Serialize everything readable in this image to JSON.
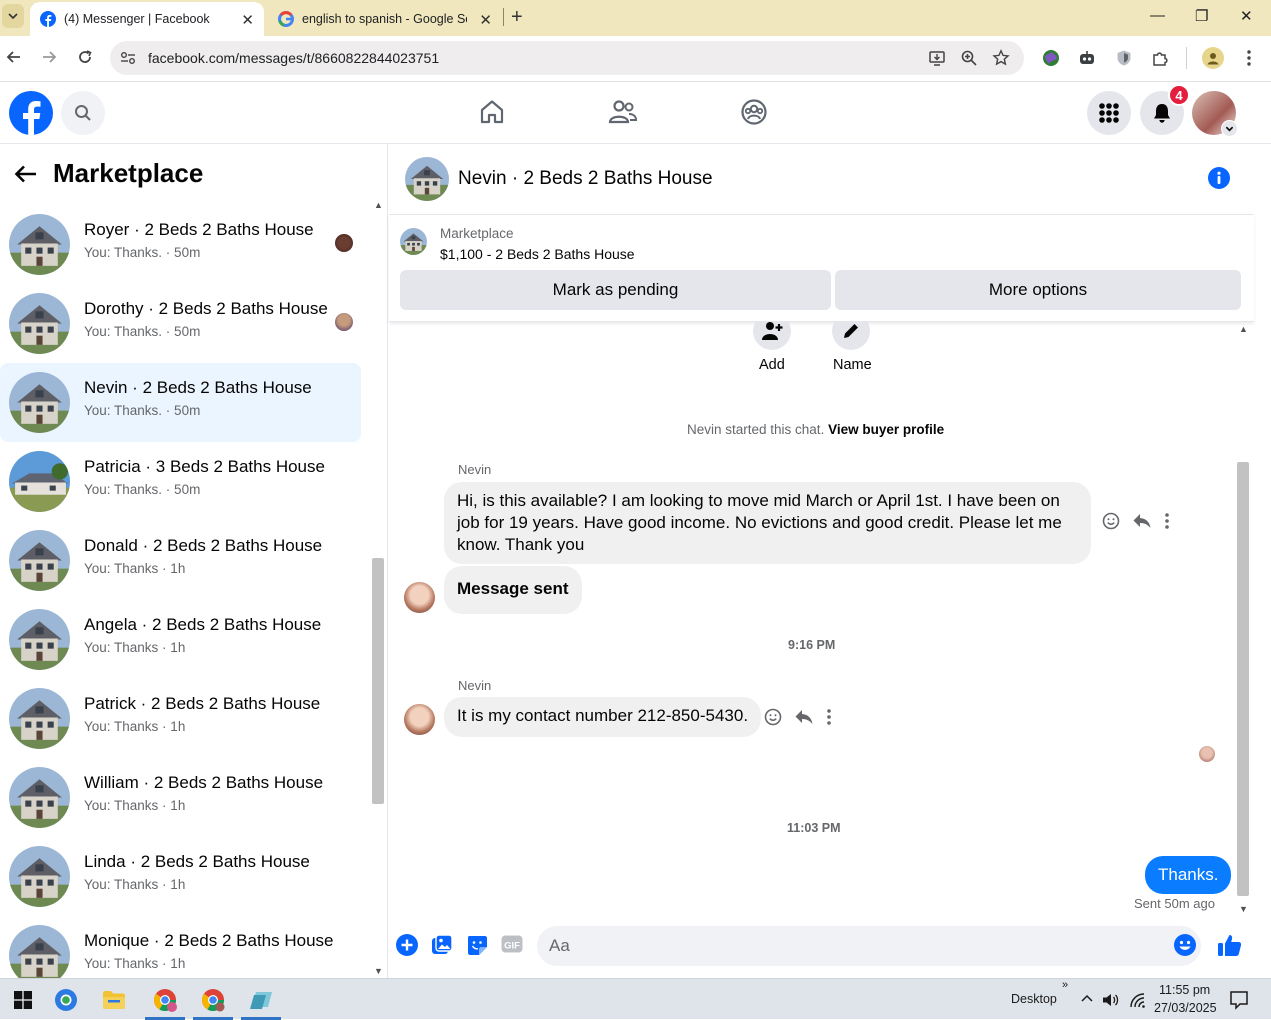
{
  "browser": {
    "tabs": [
      {
        "title": "(4) Messenger | Facebook",
        "active": true
      },
      {
        "title": "english to spanish - Google Sea",
        "active": false
      }
    ],
    "url": "facebook.com/messages/t/8660822844023751"
  },
  "fb_header": {
    "notification_count": "4"
  },
  "sidebar": {
    "title": "Marketplace",
    "conversations": [
      {
        "name": "Royer · 2 Beds 2 Baths House",
        "preview": "You: Thanks. · 50m",
        "selected": false
      },
      {
        "name": "Dorothy · 2 Beds 2 Baths House",
        "preview": "You: Thanks. · 50m",
        "selected": false
      },
      {
        "name": "Nevin · 2 Beds 2 Baths House",
        "preview": "You: Thanks. · 50m",
        "selected": true
      },
      {
        "name": "Patricia · 3 Beds 2 Baths House",
        "preview": "You: Thanks. · 50m",
        "selected": false
      },
      {
        "name": "Donald · 2 Beds 2 Baths House",
        "preview": "You: Thanks · 1h",
        "selected": false
      },
      {
        "name": "Angela · 2 Beds 2 Baths House",
        "preview": "You: Thanks · 1h",
        "selected": false
      },
      {
        "name": "Patrick · 2 Beds 2 Baths House",
        "preview": "You: Thanks · 1h",
        "selected": false
      },
      {
        "name": "William · 2 Beds 2 Baths House",
        "preview": "You: Thanks · 1h",
        "selected": false
      },
      {
        "name": "Linda · 2 Beds 2 Baths House",
        "preview": "You: Thanks · 1h",
        "selected": false
      },
      {
        "name": "Monique · 2 Beds 2 Baths House",
        "preview": "You: Thanks · 1h",
        "selected": false
      }
    ]
  },
  "chat": {
    "title": "Nevin · 2 Beds 2 Baths House",
    "listing": {
      "kind": "Marketplace",
      "title": "$1,100 - 2 Beds 2 Baths House",
      "pending_label": "Mark as pending",
      "more_label": "More options"
    },
    "actions": {
      "add_label": "Add",
      "name_label": "Name"
    },
    "system": {
      "started": "Nevin started this chat.",
      "profile_link": "View buyer profile"
    },
    "messages": [
      {
        "sender": "Nevin",
        "text": "Hi, is this available? I am looking to move mid March or April 1st. I have been on job for 19 years. Have good income. No evictions and good credit. Please let me know. Thank you"
      },
      {
        "sender": "",
        "text": "Message sent"
      },
      {
        "sender": "Nevin",
        "text": "It is my contact number 212-850-5430."
      },
      {
        "sender": "You",
        "text": "Thanks."
      }
    ],
    "times": [
      "9:16 PM",
      "11:03 PM"
    ],
    "sent_status": "Sent 50m ago",
    "composer_placeholder": "Aa"
  },
  "taskbar": {
    "desktop_label": "Desktop",
    "time": "11:55 pm",
    "date": "27/03/2025"
  },
  "colors": {
    "fb_blue": "#0866ff",
    "bubble_blue": "#0a7cff",
    "tab_strip": "#f0e7be",
    "badge_red": "#e41e3f"
  }
}
